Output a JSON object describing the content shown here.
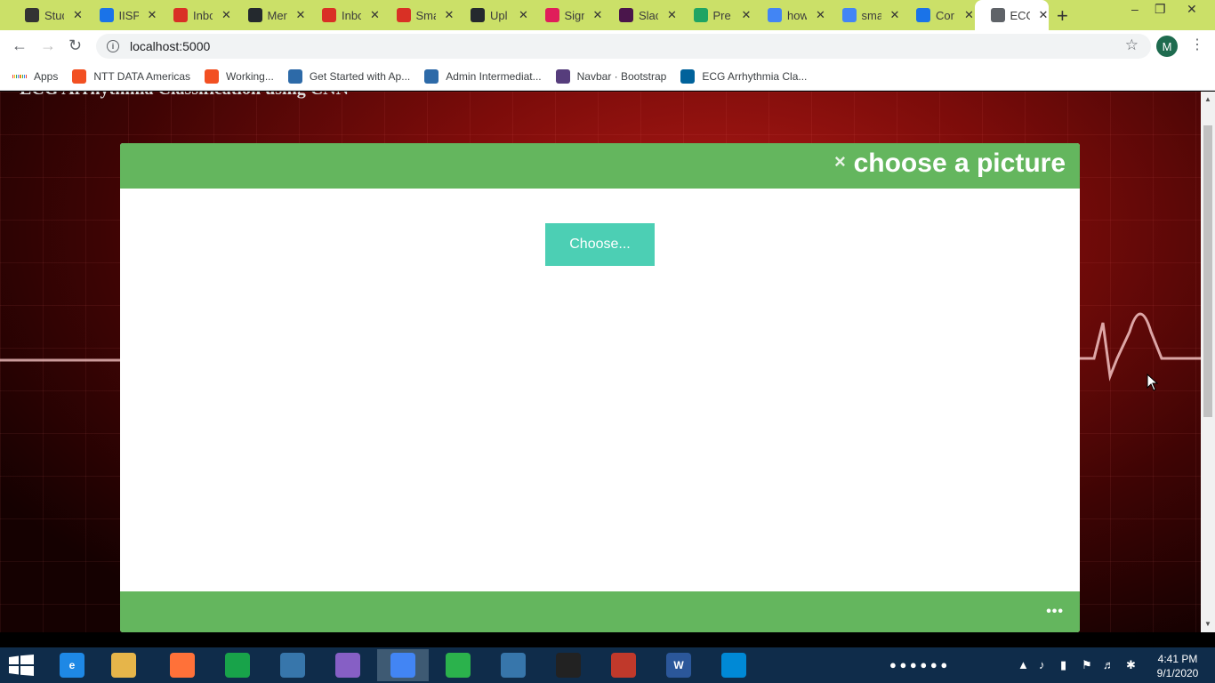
{
  "browser": {
    "tabs": [
      {
        "title": "Stud",
        "icon": "github-icon",
        "color": "#333333"
      },
      {
        "title": "IISP",
        "icon": "document-icon",
        "color": "#1a73e8"
      },
      {
        "title": "Inbo",
        "icon": "gmail-icon",
        "color": "#d93025"
      },
      {
        "title": "Mer",
        "icon": "github-icon",
        "color": "#24292e"
      },
      {
        "title": "Inbo",
        "icon": "gmail-icon",
        "color": "#d93025"
      },
      {
        "title": "Sma",
        "icon": "gmail-icon",
        "color": "#d93025"
      },
      {
        "title": "Upl",
        "icon": "github-icon",
        "color": "#24292e"
      },
      {
        "title": "Sign",
        "icon": "slack-icon",
        "color": "#e01e5a"
      },
      {
        "title": "Slac",
        "icon": "slack-icon",
        "color": "#4a154b"
      },
      {
        "title": "Pre",
        "icon": "drive-icon",
        "color": "#1fa463"
      },
      {
        "title": "how",
        "icon": "google-icon",
        "color": "#4285f4"
      },
      {
        "title": "sma",
        "icon": "google-icon",
        "color": "#4285f4"
      },
      {
        "title": "Cor",
        "icon": "calendar-icon",
        "color": "#1a73e8"
      },
      {
        "title": "ECG",
        "icon": "globe-icon",
        "color": "#5f6368",
        "active": true
      }
    ],
    "url": "localhost:5000",
    "profile_initial": "M",
    "bookmarks": [
      {
        "label": "Apps",
        "icon": "apps-grid-icon"
      },
      {
        "label": "NTT DATA Americas",
        "icon": "windows-icon"
      },
      {
        "label": "Working...",
        "icon": "windows-icon"
      },
      {
        "label": "Get Started with Ap...",
        "icon": "stack-icon"
      },
      {
        "label": "Admin Intermediat...",
        "icon": "stack-icon"
      },
      {
        "label": "Navbar · Bootstrap",
        "icon": "bootstrap-icon"
      },
      {
        "label": "ECG Arrhythmia Cla...",
        "icon": "ieee-icon"
      }
    ]
  },
  "page": {
    "heading_cut": "ECG Arrhythmia Classification using CNN"
  },
  "modal": {
    "close_symbol": "×",
    "title": "choose a picture",
    "choose_button": "Choose...",
    "footer_dots": "•••",
    "colors": {
      "header": "#64b65e",
      "button": "#4ccfb4"
    }
  },
  "taskbar": {
    "apps": [
      {
        "name": "internet-explorer-icon",
        "color": "#1e88e5",
        "label": "e"
      },
      {
        "name": "file-explorer-icon",
        "color": "#e6b54a",
        "label": ""
      },
      {
        "name": "firefox-icon",
        "color": "#ff7139",
        "label": ""
      },
      {
        "name": "store-icon",
        "color": "#18a34a",
        "label": ""
      },
      {
        "name": "python-idle-icon",
        "color": "#3776ab",
        "label": ""
      },
      {
        "name": "visual-studio-icon",
        "color": "#865fc5",
        "label": ""
      },
      {
        "name": "chrome-icon",
        "color": "#4285f4",
        "label": "",
        "active": true
      },
      {
        "name": "camtasia-icon",
        "color": "#2bb24c",
        "label": ""
      },
      {
        "name": "python-icon",
        "color": "#3776ab",
        "label": ""
      },
      {
        "name": "terminal-icon",
        "color": "#222222",
        "label": ""
      },
      {
        "name": "network-app-icon",
        "color": "#c0392b",
        "label": ""
      },
      {
        "name": "word-icon",
        "color": "#2b579a",
        "label": "W"
      },
      {
        "name": "azure-icon",
        "color": "#0089d6",
        "label": ""
      }
    ],
    "time": "4:41 PM",
    "date": "9/1/2020"
  }
}
